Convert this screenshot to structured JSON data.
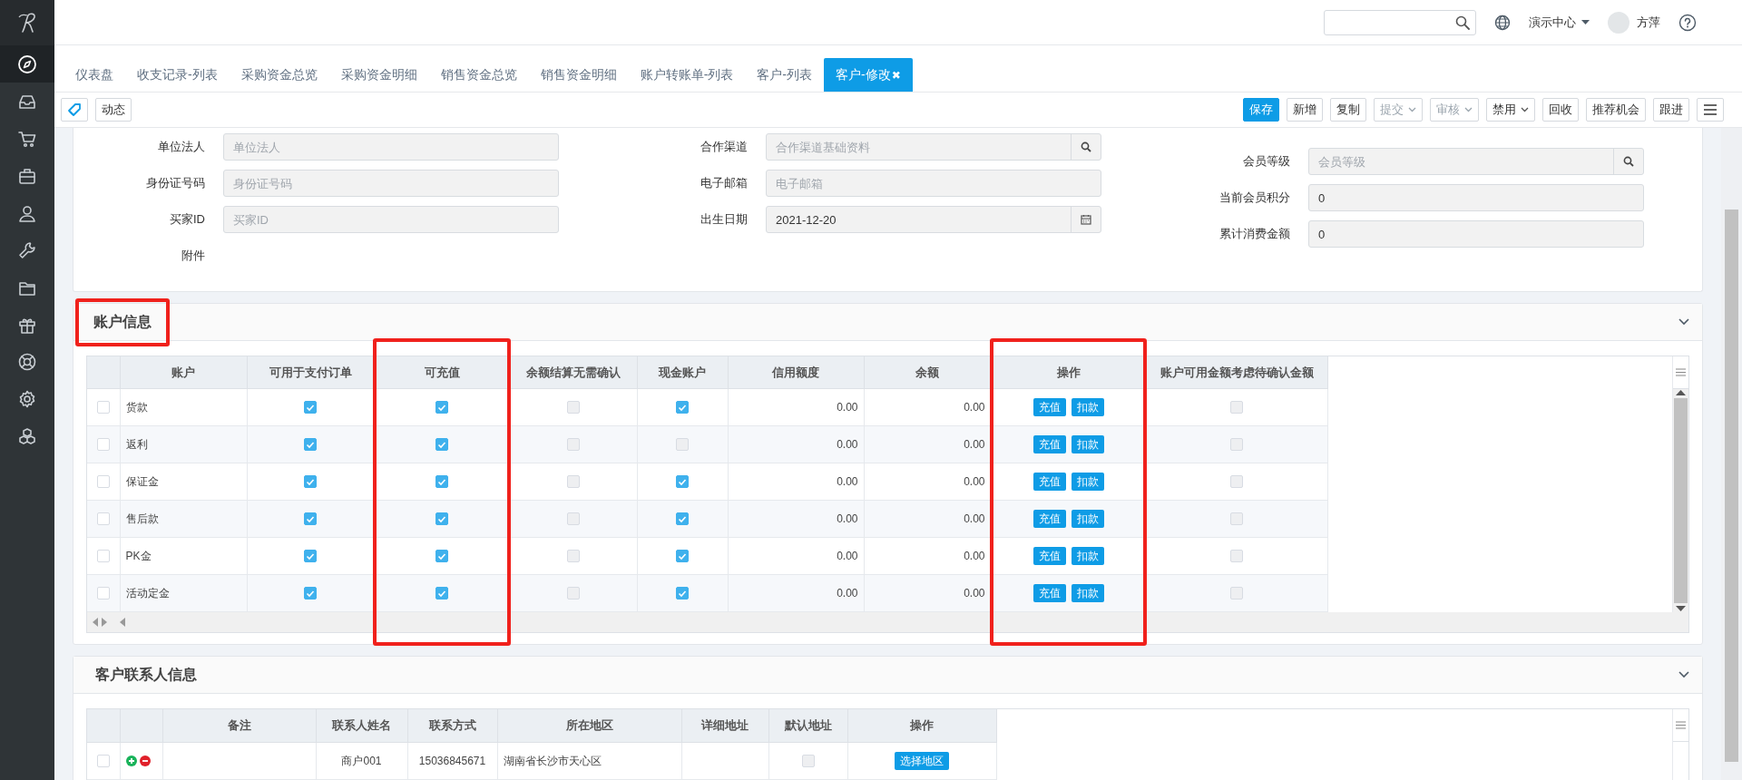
{
  "sidebar": {
    "items": [
      {
        "kind": "compass",
        "selected": true
      },
      {
        "kind": "inbox",
        "selected": false
      },
      {
        "kind": "cart",
        "selected": false
      },
      {
        "kind": "briefcase",
        "selected": false
      },
      {
        "kind": "user",
        "selected": false
      },
      {
        "kind": "wrench",
        "selected": false
      },
      {
        "kind": "folder",
        "selected": false
      },
      {
        "kind": "gift",
        "selected": false
      },
      {
        "kind": "lifebuoy",
        "selected": false
      },
      {
        "kind": "gear",
        "selected": false
      },
      {
        "kind": "cubes",
        "selected": false
      }
    ]
  },
  "topbar": {
    "org": "演示中心",
    "user": "方萍"
  },
  "tabs": [
    {
      "label": "仪表盘",
      "selected": false
    },
    {
      "label": "收支记录-列表",
      "selected": false
    },
    {
      "label": "采购资金总览",
      "selected": false
    },
    {
      "label": "采购资金明细",
      "selected": false
    },
    {
      "label": "销售资金总览",
      "selected": false
    },
    {
      "label": "销售资金明细",
      "selected": false
    },
    {
      "label": "账户转账单-列表",
      "selected": false
    },
    {
      "label": "客户-列表",
      "selected": false
    },
    {
      "label": "客户-修改",
      "selected": true,
      "close": "✖"
    }
  ],
  "toolbar": {
    "left": [
      {
        "kind": "icon"
      },
      {
        "kind": "text",
        "label": "动态"
      }
    ],
    "right": [
      {
        "kind": "primary",
        "label": "保存",
        "disabled": false
      },
      {
        "kind": "plain",
        "label": "新增",
        "disabled": false
      },
      {
        "kind": "plain",
        "label": "复制",
        "disabled": false
      },
      {
        "kind": "dropdown",
        "label": "提交",
        "disabled": true
      },
      {
        "kind": "dropdown",
        "label": "审核",
        "disabled": true
      },
      {
        "kind": "dropdown",
        "label": "禁用",
        "disabled": false
      },
      {
        "kind": "plain",
        "label": "回收",
        "disabled": false
      },
      {
        "kind": "plain",
        "label": "推荐机会",
        "disabled": false
      },
      {
        "kind": "plain",
        "label": "跟进",
        "disabled": false
      },
      {
        "kind": "menu",
        "disabled": false
      }
    ]
  },
  "form": {
    "columns": [
      [
        {
          "label": "单位法人",
          "kind": "text",
          "placeholder": "单位法人"
        },
        {
          "label": "身份证号码",
          "kind": "text",
          "placeholder": "身份证号码"
        },
        {
          "label": "买家ID",
          "kind": "text",
          "placeholder": "买家ID"
        },
        {
          "label": "附件",
          "kind": "none"
        }
      ],
      [
        {
          "label": "合作渠道",
          "kind": "lookup",
          "placeholder": "合作渠道基础资料"
        },
        {
          "label": "电子邮箱",
          "kind": "text",
          "placeholder": "电子邮箱"
        },
        {
          "label": "出生日期",
          "kind": "date",
          "value": "2021-12-20"
        }
      ],
      [
        {
          "label": "会员等级",
          "kind": "lookup",
          "placeholder": "会员等级"
        },
        {
          "label": "当前会员积分",
          "kind": "text",
          "value": "0"
        },
        {
          "label": "累计消费金额",
          "kind": "text",
          "value": "0"
        }
      ]
    ]
  },
  "accounts": {
    "title": "账户信息",
    "highlighted": true,
    "columns": [
      {
        "label": "账户",
        "highlighted": false
      },
      {
        "label": "可用于支付订单",
        "highlighted": false
      },
      {
        "label": "可充值",
        "highlighted": true
      },
      {
        "label": "余额结算无需确认",
        "highlighted": false
      },
      {
        "label": "现金账户",
        "highlighted": false
      },
      {
        "label": "信用额度",
        "highlighted": false
      },
      {
        "label": "余额",
        "highlighted": false
      },
      {
        "label": "操作",
        "highlighted": true
      },
      {
        "label": "账户可用金额考虑待确认金额",
        "highlighted": false
      }
    ],
    "rows": [
      {
        "selected": false,
        "cells": [
          {
            "kind": "text",
            "text": "货款"
          },
          {
            "kind": "check",
            "checked": true
          },
          {
            "kind": "check",
            "checked": true
          },
          {
            "kind": "check",
            "checked": false
          },
          {
            "kind": "check",
            "checked": true
          },
          {
            "kind": "amount",
            "text": "0.00"
          },
          {
            "kind": "amount",
            "text": "0.00"
          },
          {
            "kind": "buttons",
            "buttons": [
              "充值",
              "扣款"
            ]
          },
          {
            "kind": "check",
            "checked": false
          }
        ]
      },
      {
        "selected": false,
        "cells": [
          {
            "kind": "text",
            "text": "返利"
          },
          {
            "kind": "check",
            "checked": true
          },
          {
            "kind": "check",
            "checked": true
          },
          {
            "kind": "check",
            "checked": false
          },
          {
            "kind": "check",
            "checked": false
          },
          {
            "kind": "amount",
            "text": "0.00"
          },
          {
            "kind": "amount",
            "text": "0.00"
          },
          {
            "kind": "buttons",
            "buttons": [
              "充值",
              "扣款"
            ]
          },
          {
            "kind": "check",
            "checked": false
          }
        ]
      },
      {
        "selected": false,
        "cells": [
          {
            "kind": "text",
            "text": "保证金"
          },
          {
            "kind": "check",
            "checked": true
          },
          {
            "kind": "check",
            "checked": true
          },
          {
            "kind": "check",
            "checked": false
          },
          {
            "kind": "check",
            "checked": true
          },
          {
            "kind": "amount",
            "text": "0.00"
          },
          {
            "kind": "amount",
            "text": "0.00"
          },
          {
            "kind": "buttons",
            "buttons": [
              "充值",
              "扣款"
            ]
          },
          {
            "kind": "check",
            "checked": false
          }
        ]
      },
      {
        "selected": false,
        "cells": [
          {
            "kind": "text",
            "text": "售后款"
          },
          {
            "kind": "check",
            "checked": true
          },
          {
            "kind": "check",
            "checked": true
          },
          {
            "kind": "check",
            "checked": false
          },
          {
            "kind": "check",
            "checked": true
          },
          {
            "kind": "amount",
            "text": "0.00"
          },
          {
            "kind": "amount",
            "text": "0.00"
          },
          {
            "kind": "buttons",
            "buttons": [
              "充值",
              "扣款"
            ]
          },
          {
            "kind": "check",
            "checked": false
          }
        ]
      },
      {
        "selected": false,
        "cells": [
          {
            "kind": "text",
            "text": "PK金"
          },
          {
            "kind": "check",
            "checked": true
          },
          {
            "kind": "check",
            "checked": true
          },
          {
            "kind": "check",
            "checked": false
          },
          {
            "kind": "check",
            "checked": true
          },
          {
            "kind": "amount",
            "text": "0.00"
          },
          {
            "kind": "amount",
            "text": "0.00"
          },
          {
            "kind": "buttons",
            "buttons": [
              "充值",
              "扣款"
            ]
          },
          {
            "kind": "check",
            "checked": false
          }
        ]
      },
      {
        "selected": false,
        "cells": [
          {
            "kind": "text",
            "text": "活动定金"
          },
          {
            "kind": "check",
            "checked": true
          },
          {
            "kind": "check",
            "checked": true
          },
          {
            "kind": "check",
            "checked": false
          },
          {
            "kind": "check",
            "checked": true
          },
          {
            "kind": "amount",
            "text": "0.00"
          },
          {
            "kind": "amount",
            "text": "0.00"
          },
          {
            "kind": "buttons",
            "buttons": [
              "充值",
              "扣款"
            ]
          },
          {
            "kind": "check",
            "checked": false
          }
        ]
      }
    ]
  },
  "contacts": {
    "title": "客户联系人信息",
    "highlighted": false,
    "columns": [
      {
        "label": "备注",
        "highlighted": false
      },
      {
        "label": "联系人姓名",
        "highlighted": false
      },
      {
        "label": "联系方式",
        "highlighted": false
      },
      {
        "label": "所在地区",
        "highlighted": false
      },
      {
        "label": "详细地址",
        "highlighted": false
      },
      {
        "label": "默认地址",
        "highlighted": false
      },
      {
        "label": "操作",
        "highlighted": false
      }
    ],
    "rows": [
      {
        "selected": false,
        "cells": [
          {
            "kind": "empty"
          },
          {
            "kind": "code",
            "text": "商户001"
          },
          {
            "kind": "code",
            "text": "15036845671"
          },
          {
            "kind": "text",
            "text": "湖南省长沙市天心区"
          },
          {
            "kind": "empty"
          },
          {
            "kind": "check",
            "checked": false
          },
          {
            "kind": "buttons",
            "buttons": [
              "选择地区"
            ]
          }
        ]
      }
    ]
  }
}
